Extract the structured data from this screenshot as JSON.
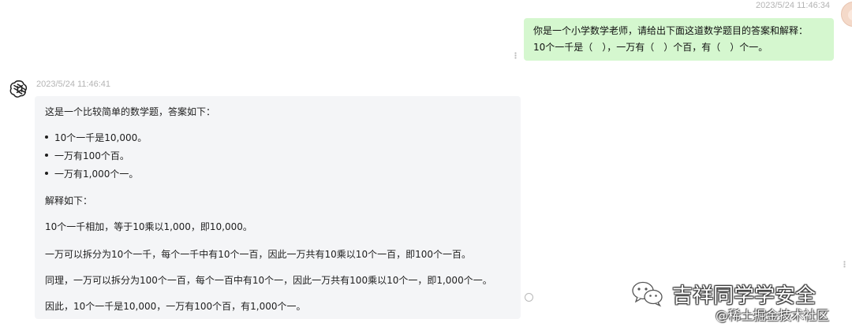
{
  "user_message": {
    "timestamp": "2023/5/24 11:46:34",
    "lines": [
      "你是一个小学数学老师，请给出下面这道数学题目的答案和解释：",
      "10个一千是（　），一万有（　）个百，有（　）个一。"
    ]
  },
  "bot_message": {
    "timestamp": "2023/5/24 11:46:41",
    "intro": "这是一个比较简单的数学题，答案如下：",
    "bullets": [
      "10个一千是10,000。",
      "一万有100个百。",
      "一万有1,000个一。"
    ],
    "explain_heading": "解释如下：",
    "paragraphs": [
      "10个一千相加，等于10乘以1,000，即10,000。",
      "一万可以拆分为10个一千，每个一千中有10个一百，因此一万共有10乘以10个一百，即100个一百。",
      "同理，一万可以拆分为100个一百，每个一百中有10个一，因此一万共有100乘以10个一，即1,000个一。",
      "因此，10个一千是10,000，一万有100个百，有1,000个一。"
    ]
  },
  "watermark": {
    "name": "吉祥同学学安全",
    "sub": "@稀土掘金技术社区"
  },
  "colors": {
    "user_bubble": "#d5f7cf",
    "bot_bubble": "#f4f5f7",
    "timestamp": "#b4b4b4"
  },
  "icons": [
    "openai-logo-icon",
    "user-avatar-icon",
    "wechat-icon",
    "drag-handle-icon",
    "copy-icon"
  ]
}
